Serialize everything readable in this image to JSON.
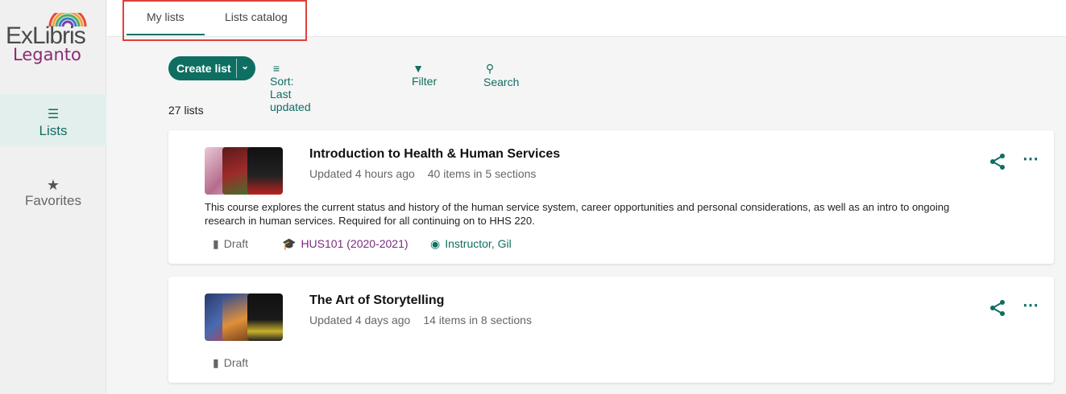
{
  "brand": {
    "line1": "ExLibris",
    "line2": "Leganto"
  },
  "sidebar": {
    "items": [
      {
        "label": "Lists",
        "icon": "list-icon",
        "active": true
      },
      {
        "label": "Favorites",
        "icon": "star-icon",
        "active": false
      }
    ]
  },
  "tabs": [
    {
      "label": "My lists",
      "active": true
    },
    {
      "label": "Lists catalog",
      "active": false
    }
  ],
  "toolbar": {
    "create_label": "Create list",
    "sort_label": "Sort: Last updated",
    "filter_label": "Filter",
    "search_label": "Search"
  },
  "list_count": "27 lists",
  "lists": [
    {
      "title": "Introduction to Health & Human Services",
      "updated": "Updated 4 hours ago",
      "items": "40 items in 5 sections",
      "description": "This course explores the current status and history of the human service system, career opportunities and personal considerations, as well as an intro to ongoing research in human services. Required for all continuing on to HHS 220.",
      "status": "Draft",
      "course": "HUS101 (2020-2021)",
      "instructor": "Instructor, Gil"
    },
    {
      "title": "The Art of Storytelling",
      "updated": "Updated 4 days ago",
      "items": "14 items in 8 sections",
      "status": "Draft"
    }
  ],
  "colors": {
    "accent": "#0f6e62",
    "course": "#7a2a80",
    "highlight": "#e0403a"
  }
}
